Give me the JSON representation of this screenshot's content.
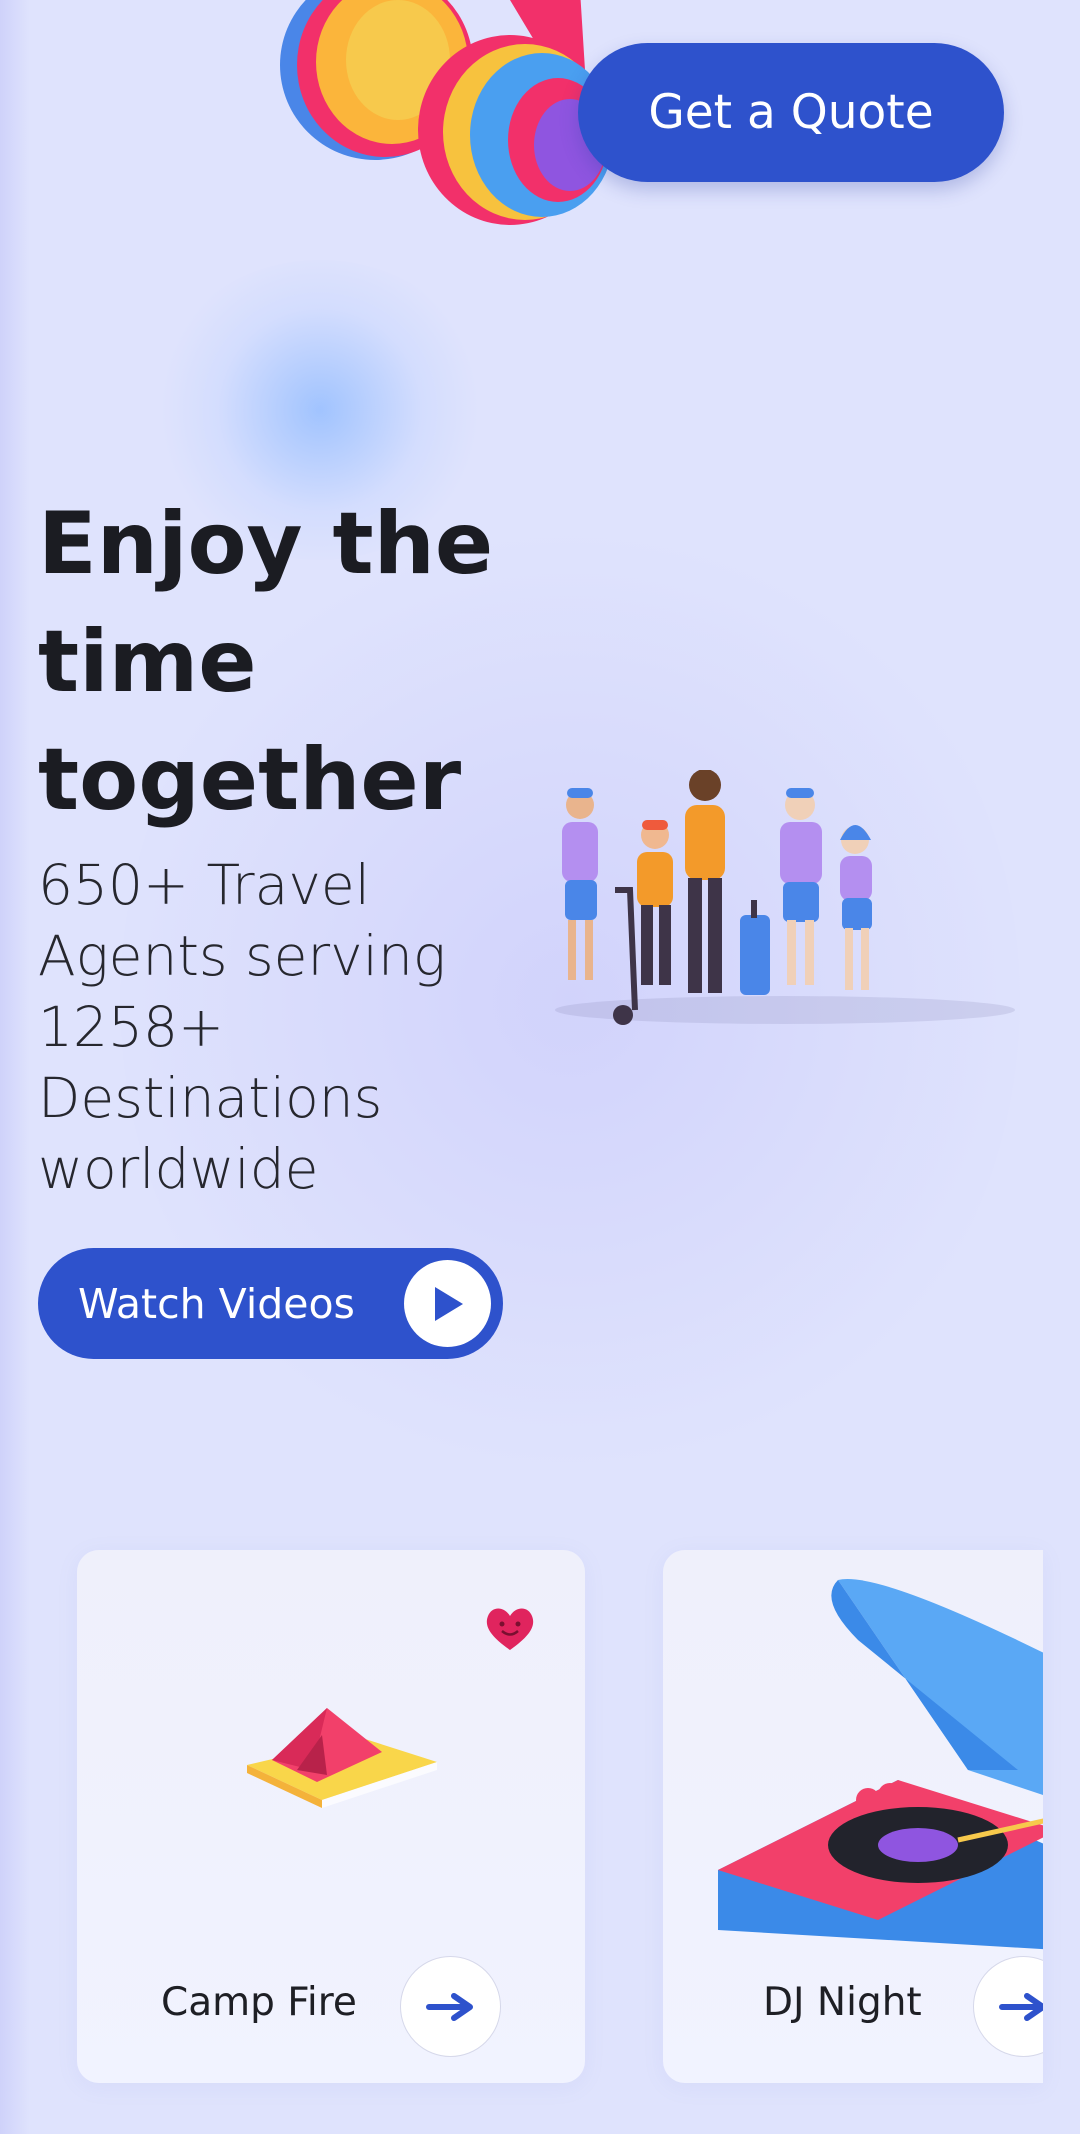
{
  "header": {
    "quote_button": "Get a Quote"
  },
  "hero": {
    "title_lines": [
      "Enjoy the",
      "time",
      "together"
    ],
    "subtitle_lines": [
      "650+ Travel",
      "Agents serving",
      "1258+",
      "Destinations",
      "worldwide"
    ],
    "watch_button": "Watch Videos"
  },
  "cards": [
    {
      "title": "Camp Fire",
      "icon": "tent-icon",
      "favorite": true
    },
    {
      "title": "DJ Night",
      "icon": "turntable-icon"
    }
  ],
  "colors": {
    "accent": "#2e52cc",
    "background": "#dfe3fd",
    "heart": "#e0245e"
  }
}
